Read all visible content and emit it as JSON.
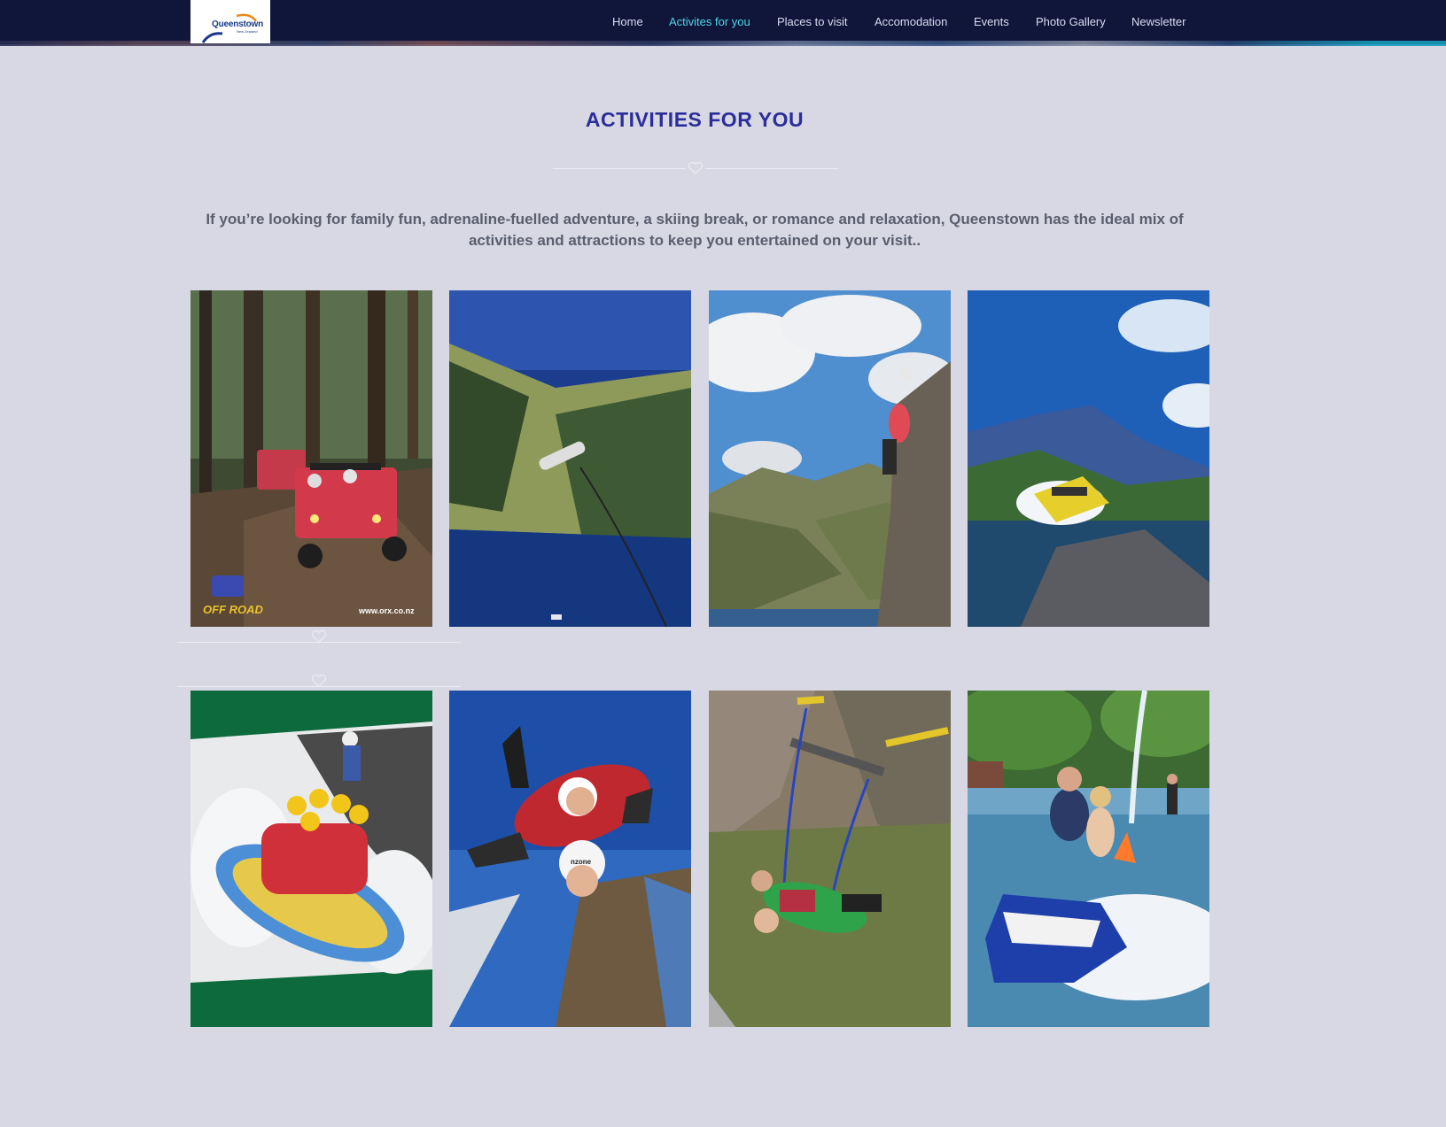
{
  "header": {
    "logo": {
      "name": "Queenstown",
      "sub": "New Zealand"
    },
    "nav": [
      {
        "label": "Home",
        "active": false
      },
      {
        "label": "Activites for you",
        "active": true
      },
      {
        "label": "Places to visit",
        "active": false
      },
      {
        "label": "Accomodation",
        "active": false
      },
      {
        "label": "Events",
        "active": false
      },
      {
        "label": "Photo Gallery",
        "active": false
      },
      {
        "label": "Newsletter",
        "active": false
      }
    ]
  },
  "main": {
    "title": "ACTIVITIES FOR YOU",
    "intro": "If you’re looking for family fun, adrenaline-fuelled adventure, a skiing break, or romance and relaxation, Queenstown has the ideal mix of activities and attractions to keep you entertained on your visit..",
    "photos": [
      {
        "name": "off-road-buggy-photo",
        "caption_left": "OFF ROAD",
        "caption_right": "www.orx.co.nz"
      },
      {
        "name": "bungy-jump-lake-photo"
      },
      {
        "name": "rock-climbing-photo"
      },
      {
        "name": "jet-boat-photo"
      },
      {
        "name": "white-water-rafting-photo"
      },
      {
        "name": "tandem-skydive-photo",
        "helmet_text": "nzone"
      },
      {
        "name": "canyon-swing-photo"
      },
      {
        "name": "jet-ski-photo"
      }
    ]
  },
  "colors": {
    "background": "#d8d8e4",
    "navbar": "#10163a",
    "nav_active": "#4fd6e6",
    "title": "#2b2e9a",
    "intro_text": "#5a5e6e"
  }
}
